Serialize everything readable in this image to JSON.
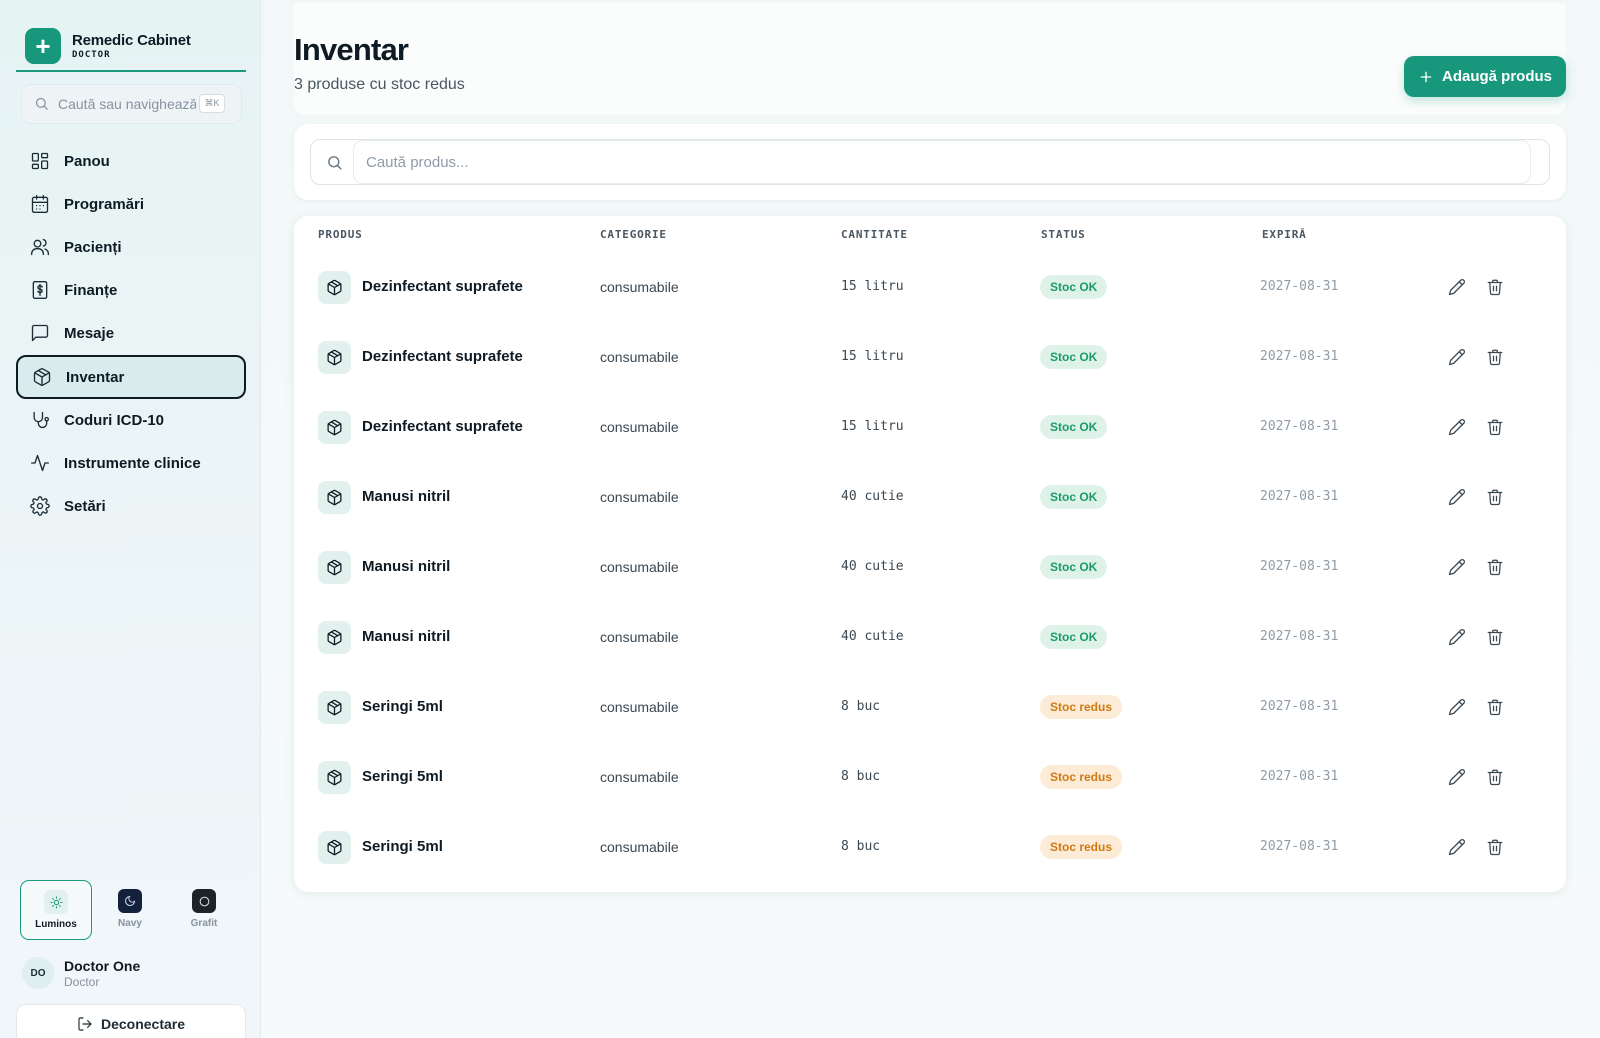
{
  "brand": {
    "name": "Remedic Cabinet",
    "role": "DOCTOR",
    "logo_symbol": "+"
  },
  "sidebar": {
    "search_placeholder": "Caută sau navighează",
    "search_shortcut": "⌘K",
    "items": [
      {
        "label": "Panou",
        "icon": "dashboard-icon"
      },
      {
        "label": "Programări",
        "icon": "calendar-icon"
      },
      {
        "label": "Pacienți",
        "icon": "users-icon"
      },
      {
        "label": "Finanțe",
        "icon": "dollar-icon"
      },
      {
        "label": "Mesaje",
        "icon": "message-icon"
      },
      {
        "label": "Inventar",
        "icon": "package-icon",
        "active": true
      },
      {
        "label": "Coduri ICD-10",
        "icon": "stethoscope-icon"
      },
      {
        "label": "Instrumente clinice",
        "icon": "activity-icon"
      },
      {
        "label": "Setări",
        "icon": "gear-icon"
      }
    ],
    "themes": [
      {
        "label": "Luminos",
        "active": true,
        "color": "#e3f1ee"
      },
      {
        "label": "Navy",
        "active": false,
        "color": "#14213d"
      },
      {
        "label": "Grafit",
        "active": false,
        "color": "#1c2226"
      }
    ],
    "user": {
      "initials": "DO",
      "name": "Doctor One",
      "role": "Doctor"
    },
    "logout_label": "Deconectare"
  },
  "page": {
    "title": "Inventar",
    "subtitle": "3 produse cu stoc redus",
    "add_button_label": "Adaugă produs",
    "search_placeholder": "Caută produs..."
  },
  "table": {
    "headers": [
      "PRODUS",
      "CATEGORIE",
      "CANTITATE",
      "STATUS",
      "EXPIRĂ"
    ],
    "rows": [
      {
        "name": "Dezinfectant suprafete",
        "category": "consumabile",
        "quantity": "15 litru",
        "status": "Stoc OK",
        "status_type": "ok",
        "expires": "2027-08-31"
      },
      {
        "name": "Dezinfectant suprafete",
        "category": "consumabile",
        "quantity": "15 litru",
        "status": "Stoc OK",
        "status_type": "ok",
        "expires": "2027-08-31"
      },
      {
        "name": "Dezinfectant suprafete",
        "category": "consumabile",
        "quantity": "15 litru",
        "status": "Stoc OK",
        "status_type": "ok",
        "expires": "2027-08-31"
      },
      {
        "name": "Manusi nitril",
        "category": "consumabile",
        "quantity": "40 cutie",
        "status": "Stoc OK",
        "status_type": "ok",
        "expires": "2027-08-31"
      },
      {
        "name": "Manusi nitril",
        "category": "consumabile",
        "quantity": "40 cutie",
        "status": "Stoc OK",
        "status_type": "ok",
        "expires": "2027-08-31"
      },
      {
        "name": "Manusi nitril",
        "category": "consumabile",
        "quantity": "40 cutie",
        "status": "Stoc OK",
        "status_type": "ok",
        "expires": "2027-08-31"
      },
      {
        "name": "Seringi 5ml",
        "category": "consumabile",
        "quantity": "8 buc",
        "status": "Stoc redus",
        "status_type": "low",
        "expires": "2027-08-31"
      },
      {
        "name": "Seringi 5ml",
        "category": "consumabile",
        "quantity": "8 buc",
        "status": "Stoc redus",
        "status_type": "low",
        "expires": "2027-08-31"
      },
      {
        "name": "Seringi 5ml",
        "category": "consumabile",
        "quantity": "8 buc",
        "status": "Stoc redus",
        "status_type": "low",
        "expires": "2027-08-31"
      }
    ]
  },
  "colors": {
    "accent": "#17987c",
    "ok_bg": "#dff2ea",
    "ok_text": "#1a9b6e",
    "low_bg": "#fcebd6",
    "low_text": "#d17a12"
  }
}
